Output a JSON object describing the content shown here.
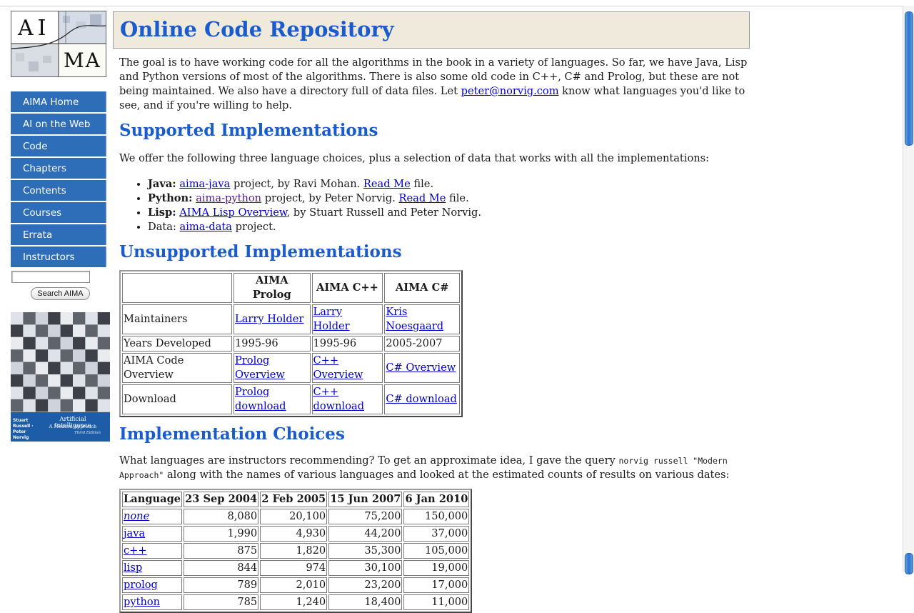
{
  "logo": {
    "top_text": "AI",
    "bottom_text": "MA"
  },
  "sidebar": {
    "items": [
      {
        "label": "AIMA Home"
      },
      {
        "label": "AI on the Web"
      },
      {
        "label": "Code"
      },
      {
        "label": "Chapters"
      },
      {
        "label": "Contents"
      },
      {
        "label": "Courses"
      },
      {
        "label": "Errata"
      },
      {
        "label": "Instructors"
      }
    ],
    "search_value": "",
    "search_button": "Search AIMA"
  },
  "book": {
    "authors": "Stuart Russell · Peter Norvig",
    "title": "Artificial Intelligence",
    "subtitle": "A Modern Approach",
    "edition": "Third Edition"
  },
  "page": {
    "title": "Online Code Repository",
    "intro_1": "The goal is to have working code for all the algorithms in the book in a variety of languages. So far, we have Java, Lisp and Python versions of most of the algorithms. There is also some old code in C++, C# and Prolog, but these are not being maintained. We also have a directory full of data files. Let ",
    "intro_email": "peter@norvig.com",
    "intro_2": " know what languages you'd like to see, and if you're willing to help."
  },
  "supported": {
    "heading": "Supported Implementations",
    "intro": "We offer the following three language choices, plus a selection of data that works with all the implementations:",
    "java": {
      "label": "Java:",
      "link": "aima-java",
      "mid": " project, by Ravi Mohan. ",
      "readme": "Read Me",
      "end": " file."
    },
    "python": {
      "label": "Python:",
      "link": "aima-python",
      "mid": " project, by Peter Norvig. ",
      "readme": "Read Me",
      "end": " file."
    },
    "lisp": {
      "label": "Lisp:",
      "link": "AIMA Lisp Overview",
      "end": ", by Stuart Russell and Peter Norvig."
    },
    "data": {
      "label": "Data: ",
      "link": "aima-data",
      "end": " project."
    }
  },
  "unsupported": {
    "heading": "Unsupported Implementations",
    "columns": [
      "",
      "AIMA Prolog",
      "AIMA C++",
      "AIMA C#"
    ],
    "rows": {
      "maintainers": {
        "label": "Maintainers",
        "cells": [
          "Larry Holder",
          "Larry Holder",
          "Kris Noesgaard"
        ]
      },
      "years": {
        "label": "Years Developed",
        "cells": [
          "1995-96",
          "1995-96",
          "2005-2007"
        ]
      },
      "overview": {
        "label": "AIMA Code Overview",
        "cells": [
          "Prolog Overview",
          "C++ Overview",
          "C# Overview"
        ]
      },
      "download": {
        "label": "Download",
        "cells": [
          "Prolog download",
          "C++ download",
          "C# download"
        ]
      }
    }
  },
  "choices": {
    "heading": "Implementation Choices",
    "text_1": "What languages are instructors recommending? To get an approximate idea, I gave the query ",
    "query": "norvig russell \"Modern Approach\"",
    "text_2": " along with the names of various languages and looked at the estimated counts of results on various dates:",
    "columns": [
      "Language",
      "23 Sep 2004",
      "2 Feb 2005",
      "15 Jun 2007",
      "6 Jan 2010"
    ],
    "rows": [
      {
        "lang": "none",
        "values": [
          "8,080",
          "20,100",
          "75,200",
          "150,000"
        ]
      },
      {
        "lang": "java",
        "values": [
          "1,990",
          "4,930",
          "44,200",
          "37,000"
        ]
      },
      {
        "lang": "c++",
        "values": [
          "875",
          "1,820",
          "35,300",
          "105,000"
        ]
      },
      {
        "lang": "lisp",
        "values": [
          "844",
          "974",
          "30,100",
          "19,000"
        ]
      },
      {
        "lang": "prolog",
        "values": [
          "789",
          "2,010",
          "23,200",
          "17,000"
        ]
      },
      {
        "lang": "python",
        "values": [
          "785",
          "1,240",
          "18,400",
          "11,000"
        ]
      }
    ]
  }
}
